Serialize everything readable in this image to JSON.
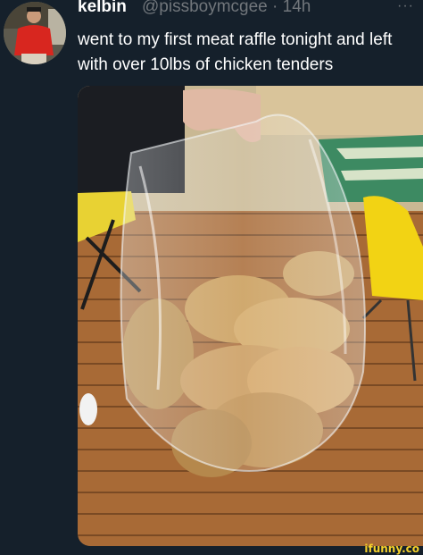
{
  "tweet": {
    "author_name": "kelbin",
    "author_handle": "@pissboymcgee",
    "time": "· 14h",
    "more_label": "···",
    "text": "went to my first meat raffle tonight and left with over 10lbs of chicken tenders"
  },
  "watermark": "ifunny.co",
  "icons": {
    "avatar": "avatar",
    "more": "more-icon"
  },
  "colors": {
    "background": "#15202b",
    "text": "#ffffff",
    "muted": "#71767b",
    "watermark": "#f4d02a"
  }
}
